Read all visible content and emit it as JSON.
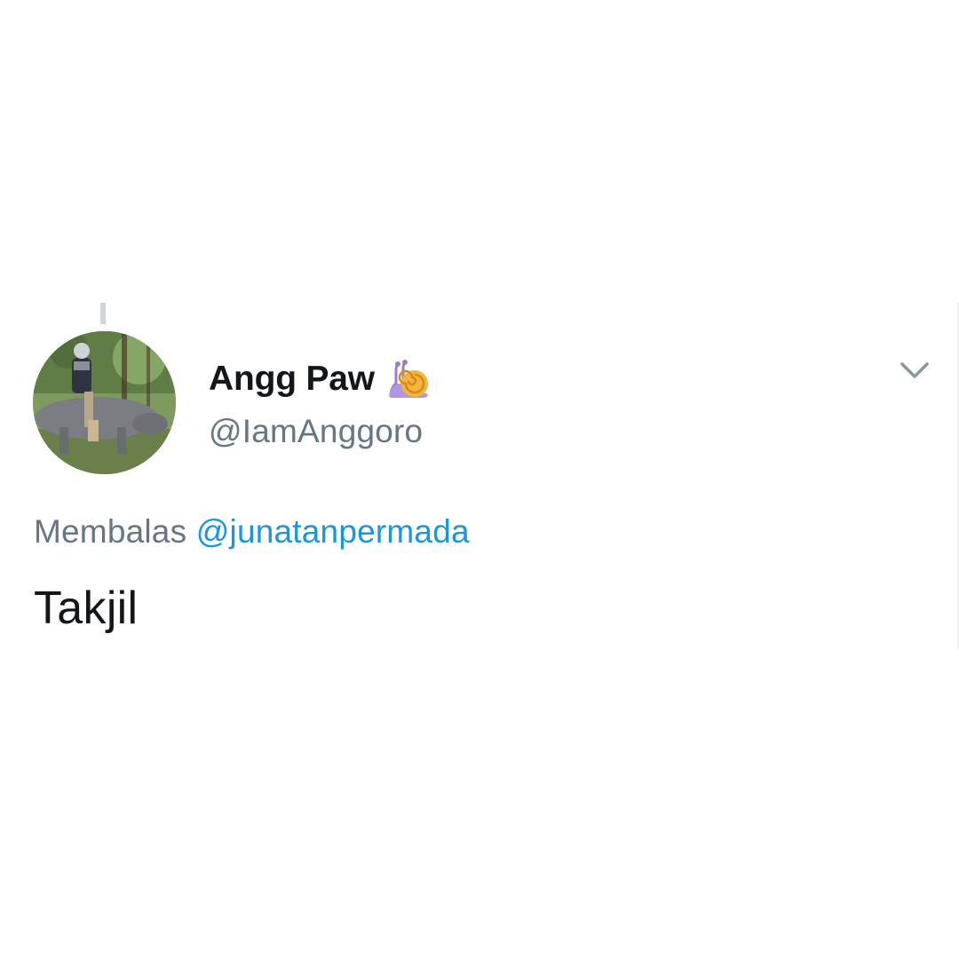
{
  "tweet": {
    "display_name": "Angg Paw",
    "name_emoji_icon": "snail-icon",
    "handle": "@IamAnggoro",
    "reply_prefix": "Membalas",
    "reply_mention": "@junatanpermada",
    "text": "Takjil",
    "menu_icon": "chevron-down-icon"
  },
  "colors": {
    "name": "#14171a",
    "secondary_text": "#657786",
    "mention": "#1b95e0",
    "thread_line": "#ccd6dd",
    "background": "#ffffff"
  }
}
